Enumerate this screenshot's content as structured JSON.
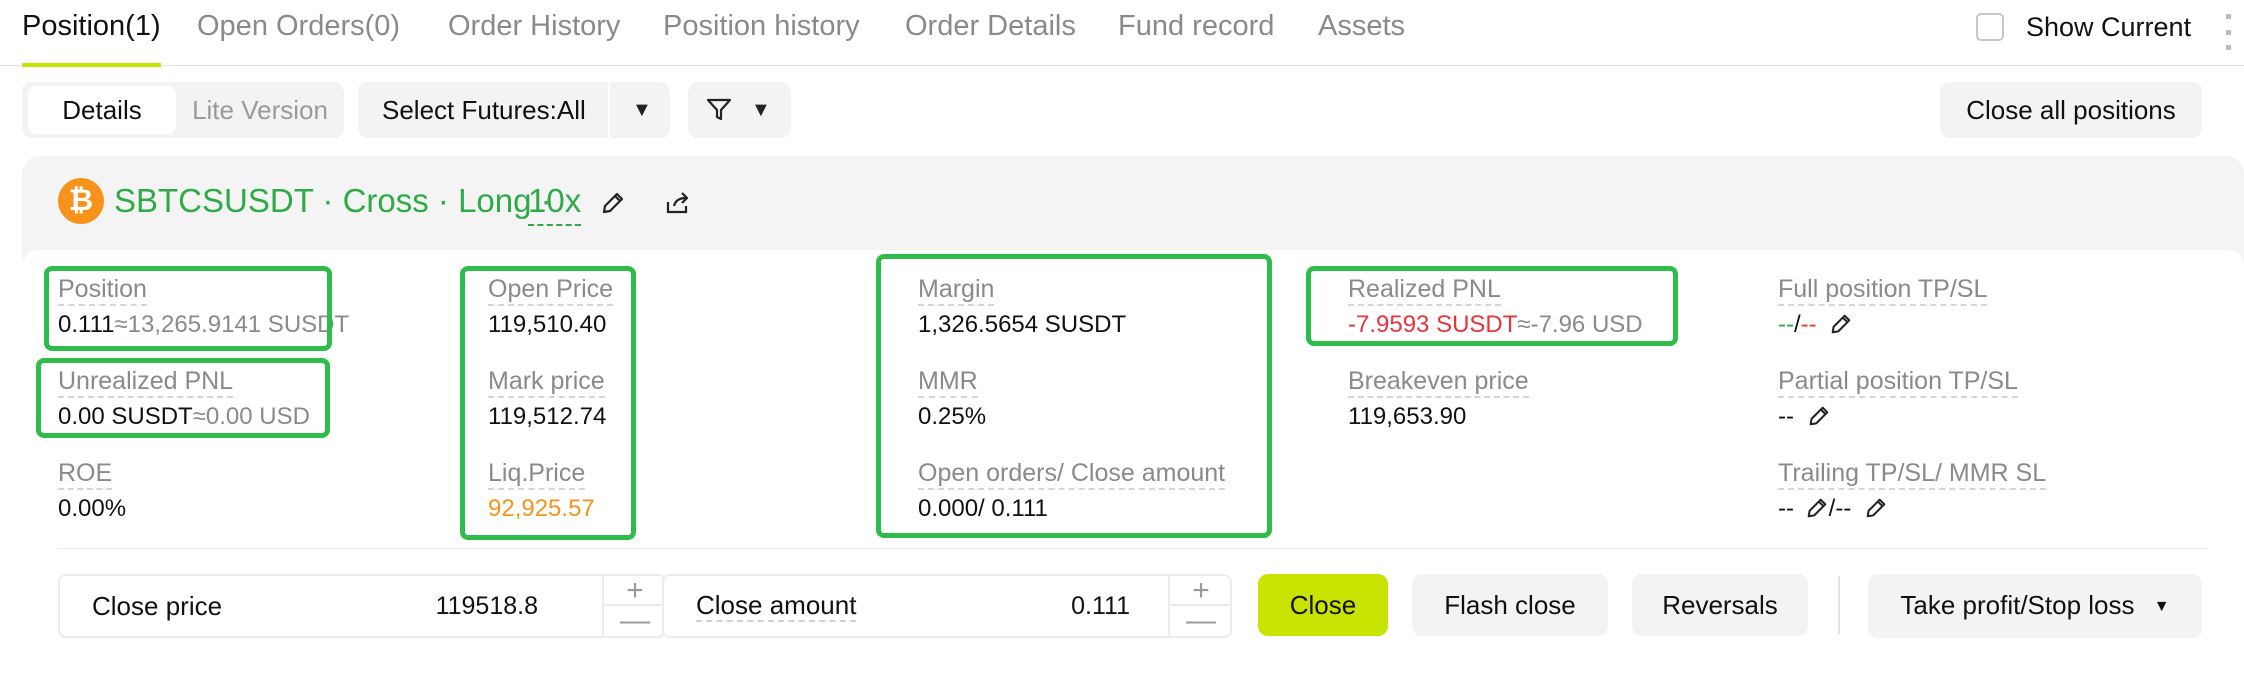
{
  "tabs": [
    {
      "label": "Position(1)"
    },
    {
      "label": "Open Orders(0)"
    },
    {
      "label": "Order History"
    },
    {
      "label": "Position history"
    },
    {
      "label": "Order Details"
    },
    {
      "label": "Fund record"
    },
    {
      "label": "Assets"
    }
  ],
  "show_current": "Show Current",
  "toolbar": {
    "details": "Details",
    "lite": "Lite Version",
    "select_futures": "Select Futures:All",
    "close_all": "Close all positions"
  },
  "position": {
    "title": "SBTCSUSDT · Cross · Long ·",
    "leverage": "10x",
    "accent_color": "#2eab47",
    "coin_icon": "bitcoin-icon",
    "coin_glyph": "₿",
    "fields": {
      "position_label": "Position",
      "position_value": "0.111",
      "position_approx": "≈13,265.9141 SUSDT",
      "unrealized_label": "Unrealized PNL",
      "unrealized_value": "0.00 SUSDT",
      "unrealized_approx": "≈0.00 USD",
      "roe_label": "ROE",
      "roe_value": "0.00%",
      "open_price_label": "Open Price",
      "open_price_value": "119,510.40",
      "mark_price_label": "Mark price",
      "mark_price_value": "119,512.74",
      "liq_price_label": "Liq.Price",
      "liq_price_value": "92,925.57",
      "margin_label": "Margin",
      "margin_value": "1,326.5654 SUSDT",
      "mmr_label": "MMR",
      "mmr_value": "0.25%",
      "oc_label": "Open orders/ Close amount",
      "oc_value": "0.000/ 0.111",
      "realized_label": "Realized PNL",
      "realized_value": "-7.9593 SUSDT",
      "realized_approx": "≈-7.96 USD",
      "breakeven_label": "Breakeven price",
      "breakeven_value": "119,653.90",
      "full_tpsl_label": "Full position TP/SL",
      "full_tp": "--",
      "full_sep": "/",
      "full_sl": "--",
      "partial_tpsl_label": "Partial position TP/SL",
      "partial_value": "--",
      "trailing_label": "Trailing TP/SL/ MMR SL",
      "trailing_a": "--",
      "trailing_sep": "/",
      "trailing_b": "--"
    }
  },
  "close_form": {
    "price_label": "Close price",
    "price_value": "119518.8",
    "amount_label": "Close amount",
    "amount_value": "0.111",
    "plus": "+",
    "minus": "—",
    "close": "Close",
    "flash_close": "Flash close",
    "reversals": "Reversals",
    "tpsl": "Take profit/Stop loss",
    "tpsl_caret": "▼"
  }
}
